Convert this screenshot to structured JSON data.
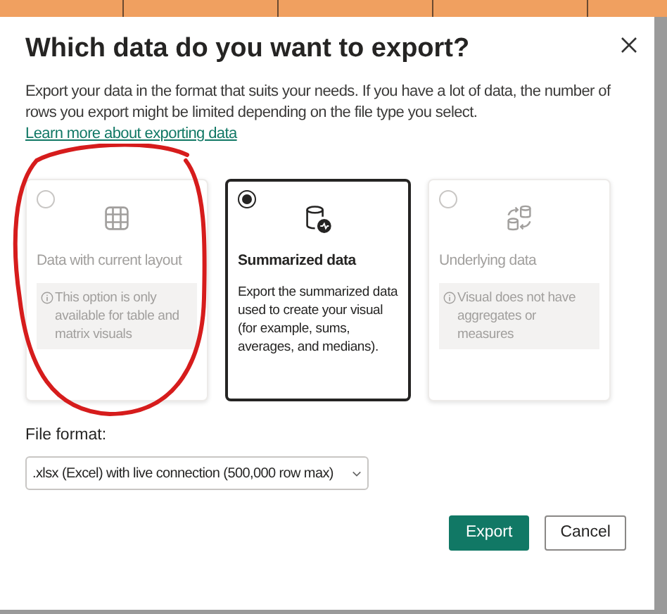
{
  "dialog": {
    "title": "Which data do you want to export?",
    "description": "Export your data in the format that suits your needs. If you have a lot of data, the number of rows you export might be limited depending on the file type you select.",
    "link": "Learn more about exporting data"
  },
  "options": [
    {
      "title": "Data with current layout",
      "text": "This option is only available for table and matrix visuals",
      "selected": false,
      "disabled": true
    },
    {
      "title": "Summarized data",
      "text": "Export the summarized data used to create your visual (for example, sums, averages, and medians).",
      "selected": true,
      "disabled": false
    },
    {
      "title": "Underlying data",
      "text": "Visual does not have aggregates or measures",
      "selected": false,
      "disabled": true
    }
  ],
  "file_format": {
    "label": "File format:",
    "value": ".xlsx (Excel) with live connection (500,000 row max)"
  },
  "buttons": [
    {
      "label": "Export",
      "primary": true
    },
    {
      "label": "Cancel",
      "primary": false
    }
  ]
}
